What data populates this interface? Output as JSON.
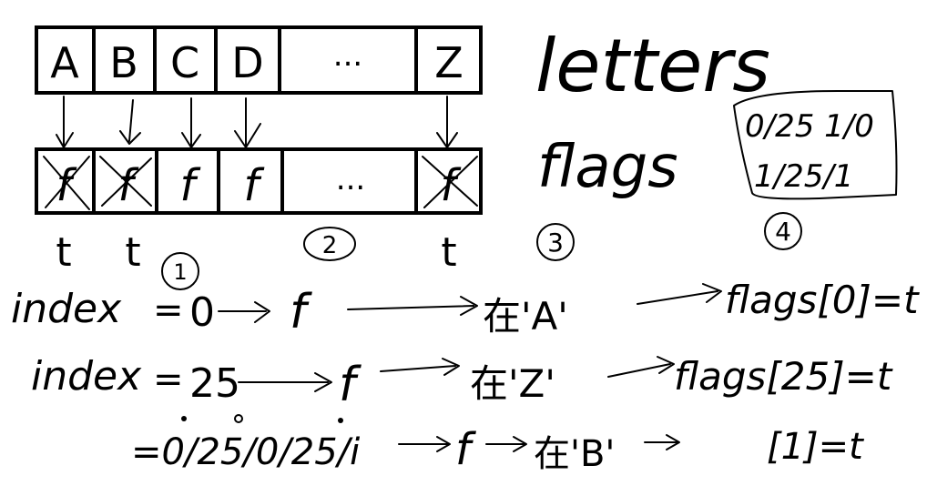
{
  "letters_row": {
    "cells": [
      "A",
      "B",
      "C",
      "D",
      "...",
      "Z"
    ]
  },
  "flags_row": {
    "cells": [
      "f",
      "f",
      "f",
      "f",
      "...",
      "f"
    ],
    "crossed": [
      true,
      true,
      false,
      false,
      false,
      true
    ],
    "below_marks": [
      "t",
      "t",
      "",
      "",
      "",
      "t"
    ]
  },
  "labels": {
    "letters": "letters",
    "flags": "flags"
  },
  "ranges_box": {
    "line1": "0/25 1/0",
    "line2": "1/25/1"
  },
  "circled_steps": {
    "one": "1",
    "two": "2",
    "three": "3",
    "four": "4"
  },
  "eq_row1": {
    "lhs": "index",
    "eq": "=",
    "n": "0",
    "f": "f",
    "cond": "在'A'",
    "result": "flags[0]=t"
  },
  "eq_row2": {
    "lhs": "index",
    "eq": "=",
    "n": "25",
    "f": "f",
    "cond": "在'Z'",
    "result": "flags[25]=t"
  },
  "eq_row3": {
    "prefix": "=0/25/0/25/i",
    "f": "f",
    "cond": "在'B'",
    "result": "[1]=t"
  }
}
